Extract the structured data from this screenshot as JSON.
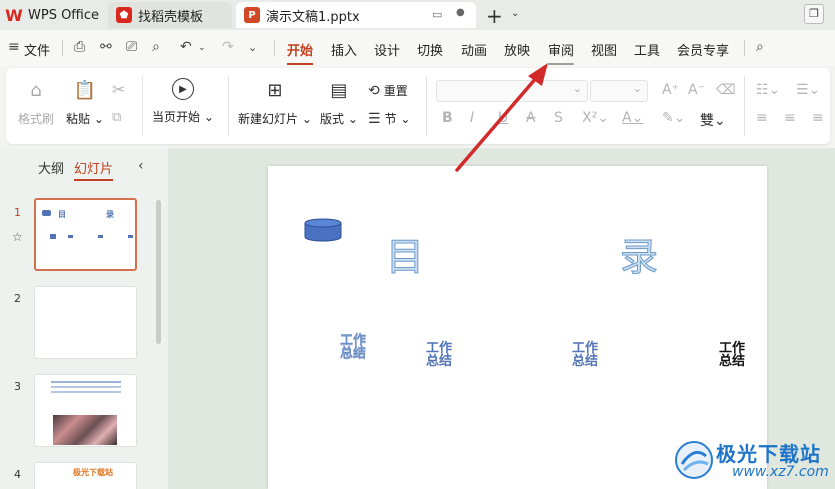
{
  "titlebar": {
    "wps_tab": "WPS Office",
    "template_tab": "找稻壳模板",
    "doc_tab": "演示文稿1.pptx"
  },
  "menu": {
    "file": "文件",
    "items": [
      "开始",
      "插入",
      "设计",
      "切换",
      "动画",
      "放映",
      "审阅",
      "视图",
      "工具",
      "会员专享"
    ],
    "active": "开始"
  },
  "ribbon": {
    "format_painter": "格式刷",
    "paste": "粘贴",
    "play_current": "当页开始",
    "new_slide": "新建幻灯片",
    "layout": "版式",
    "reset": "重置",
    "section": "节"
  },
  "panel": {
    "outline_tab": "大纲",
    "slides_tab": "幻灯片",
    "slide_numbers": [
      "1",
      "2",
      "3",
      "4"
    ],
    "thumb4_title": "极光下载站"
  },
  "slide": {
    "char_mu": "目",
    "char_lu": "录",
    "items": [
      "工作总结",
      "工作总结",
      "工作总结",
      "工作总结"
    ]
  },
  "watermark": {
    "text": "极光下载站",
    "url": "www.xz7.com"
  },
  "colors": {
    "accent": "#c0401f",
    "arrow": "#d22a2a",
    "text_blue": "#5174b6"
  }
}
